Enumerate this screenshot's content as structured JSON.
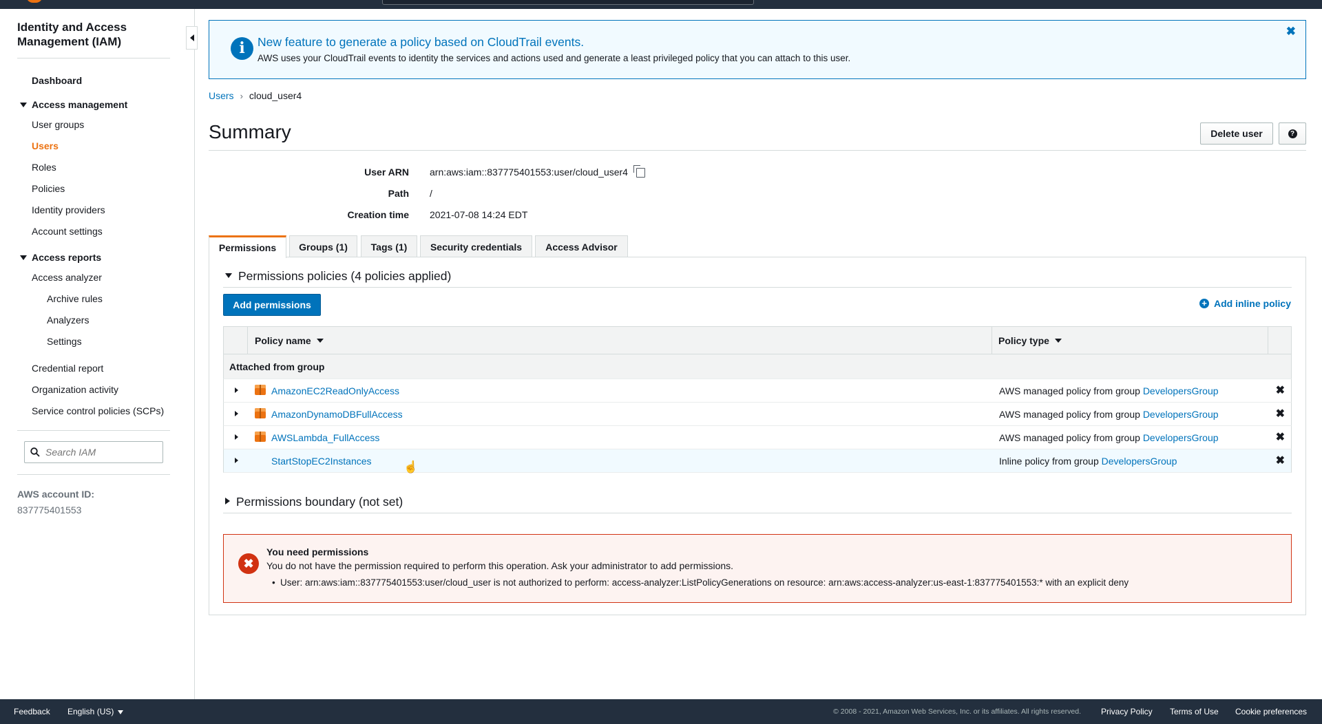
{
  "sidebar": {
    "title": "Identity and Access Management (IAM)",
    "dashboard": "Dashboard",
    "access_management": "Access management",
    "am_items": [
      "User groups",
      "Users",
      "Roles",
      "Policies",
      "Identity providers",
      "Account settings"
    ],
    "active_item": "Users",
    "access_reports": "Access reports",
    "access_analyzer": "Access analyzer",
    "analyzer_items": [
      "Archive rules",
      "Analyzers",
      "Settings"
    ],
    "report_items": [
      "Credential report",
      "Organization activity",
      "Service control policies (SCPs)"
    ],
    "search_placeholder": "Search IAM",
    "account_id_label": "AWS account ID:",
    "account_id": "837775401553"
  },
  "banner": {
    "title": "New feature to generate a policy based on CloudTrail events.",
    "description": "AWS uses your CloudTrail events to identity the services and actions used and generate a least privileged policy that you can attach to this user.",
    "close": "✖"
  },
  "breadcrumb": {
    "parent": "Users",
    "separator": "›",
    "current": "cloud_user4"
  },
  "summary": {
    "title": "Summary",
    "delete_button": "Delete user",
    "help_button": "?",
    "user_arn_label": "User ARN",
    "user_arn": "arn:aws:iam::837775401553:user/cloud_user4",
    "path_label": "Path",
    "path": "/",
    "creation_label": "Creation time",
    "creation_time": "2021-07-08 14:24 EDT"
  },
  "tabs": [
    "Permissions",
    "Groups (1)",
    "Tags (1)",
    "Security credentials",
    "Access Advisor"
  ],
  "permissions": {
    "section_title": "Permissions policies (4 policies applied)",
    "add_button": "Add permissions",
    "add_inline": "Add inline policy",
    "columns": {
      "name": "Policy name",
      "type": "Policy type"
    },
    "group_label": "Attached from group",
    "rows": [
      {
        "name": "AmazonEC2ReadOnlyAccess",
        "type_prefix": "AWS managed policy from group",
        "group": "DevelopersGroup",
        "managed": true
      },
      {
        "name": "AmazonDynamoDBFullAccess",
        "type_prefix": "AWS managed policy from group",
        "group": "DevelopersGroup",
        "managed": true
      },
      {
        "name": "AWSLambda_FullAccess",
        "type_prefix": "AWS managed policy from group",
        "group": "DevelopersGroup",
        "managed": true
      },
      {
        "name": "StartStopEC2Instances",
        "type_prefix": "Inline policy from group",
        "group": "DevelopersGroup",
        "managed": false
      }
    ],
    "remove_glyph": "✖",
    "boundary_title": "Permissions boundary (not set)"
  },
  "error": {
    "title": "You need permissions",
    "description": "You do not have the permission required to perform this operation. Ask your administrator to add permissions.",
    "detail": "User: arn:aws:iam::837775401553:user/cloud_user is not authorized to perform: access-analyzer:ListPolicyGenerations on resource: arn:aws:access-analyzer:us-east-1:837775401553:* with an explicit deny",
    "icon": "✖"
  },
  "footer": {
    "feedback": "Feedback",
    "language": "English (US)",
    "copyright": "© 2008 - 2021, Amazon Web Services, Inc. or its affiliates. All rights reserved.",
    "privacy": "Privacy Policy",
    "terms": "Terms of Use",
    "cookies": "Cookie preferences"
  },
  "colors": {
    "accent": "#ec7211",
    "link": "#0073bb",
    "nav_bg": "#232f3e",
    "error": "#d13212"
  }
}
